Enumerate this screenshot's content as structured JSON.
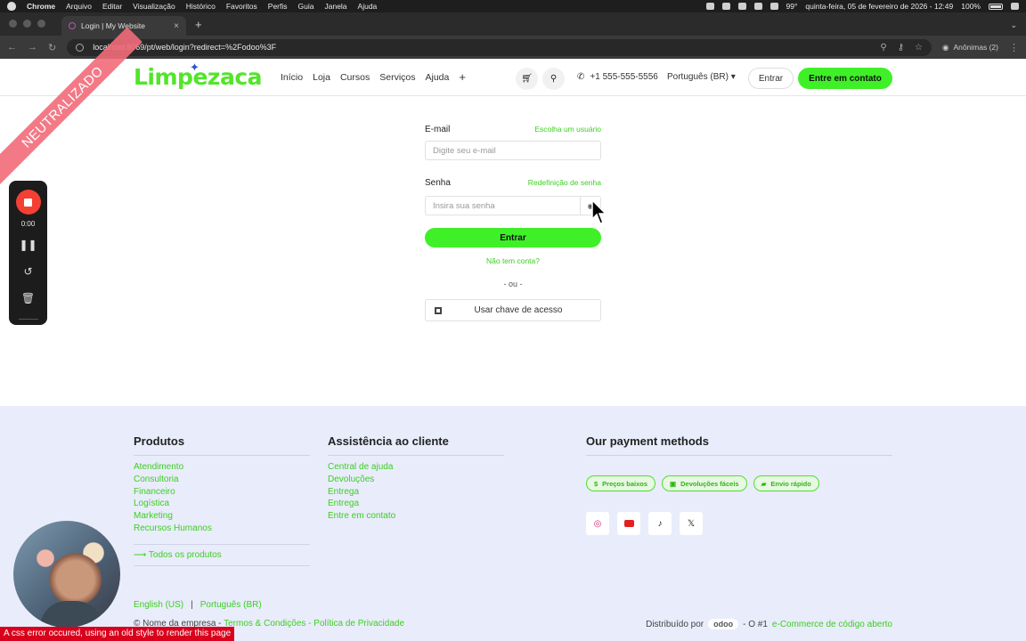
{
  "os_menubar": {
    "app": "Chrome",
    "items": [
      "Arquivo",
      "Editar",
      "Visualização",
      "Histórico",
      "Favoritos",
      "Perfis",
      "Guia",
      "Janela",
      "Ajuda"
    ],
    "temp": "99°",
    "battery": "100%",
    "datetime": "quinta-feira, 05 de fevereiro de 2026 - 12:49"
  },
  "browser": {
    "tab_title": "Login | My Website",
    "url": "localhost:8069/pt/web/login?redirect=%2Fodoo%3F",
    "profile": "Anônimas (2)"
  },
  "header": {
    "logo": "Limpezaca",
    "nav": [
      "Início",
      "Loja",
      "Cursos",
      "Serviços",
      "Ajuda"
    ],
    "phone": "+1 555-555-5556",
    "language": "Português (BR)",
    "login_button": "Entrar",
    "contact_button": "Entre em contato"
  },
  "login": {
    "email_label": "E-mail",
    "choose_user_link": "Escolha um usuário",
    "email_placeholder": "Digite seu e-mail",
    "password_label": "Senha",
    "reset_password_link": "Redefinição de senha",
    "password_placeholder": "Insira sua senha",
    "submit_button": "Entrar",
    "signup_link": "Não tem conta?",
    "divider": "- ou -",
    "passkey_button": "Usar chave de acesso"
  },
  "footer": {
    "products": {
      "title": "Produtos",
      "items": [
        "Atendimento",
        "Consultoria",
        "Financeiro",
        "Logística",
        "Marketing",
        "Recursos Humanos"
      ],
      "all_link": "⟶ Todos os produtos"
    },
    "support": {
      "title": "Assistência ao cliente",
      "items": [
        "Central de ajuda",
        "Devoluções",
        "Entrega",
        "Entrega",
        "Entre em contato"
      ]
    },
    "payment": {
      "title": "Our payment methods",
      "badges": [
        "Preços baixos",
        "Devoluções fáceis",
        "Envio rápido"
      ]
    },
    "languages": [
      "English (US)",
      "Português (BR)"
    ],
    "lang_separator": "|",
    "copyright": "© Nome da empresa - ",
    "terms": "Termos & Condições",
    "sep": " - ",
    "privacy": "Política de Privacidade",
    "powered_by": "Distribuído por",
    "odoo": "odoo",
    "powered_suffix": "- O #1",
    "ecommerce": "e-Commerce de código aberto"
  },
  "overlays": {
    "ribbon": "NEUTRALIZADO",
    "recorder_time": "0:00",
    "error_banner": "A css error occured, using an old style to render this page"
  },
  "colors": {
    "brand_green": "#3ff028",
    "link_green": "#3bcf20",
    "footer_bg": "#e9ecfb",
    "ribbon": "#f26b7a",
    "error": "#d9001b"
  }
}
